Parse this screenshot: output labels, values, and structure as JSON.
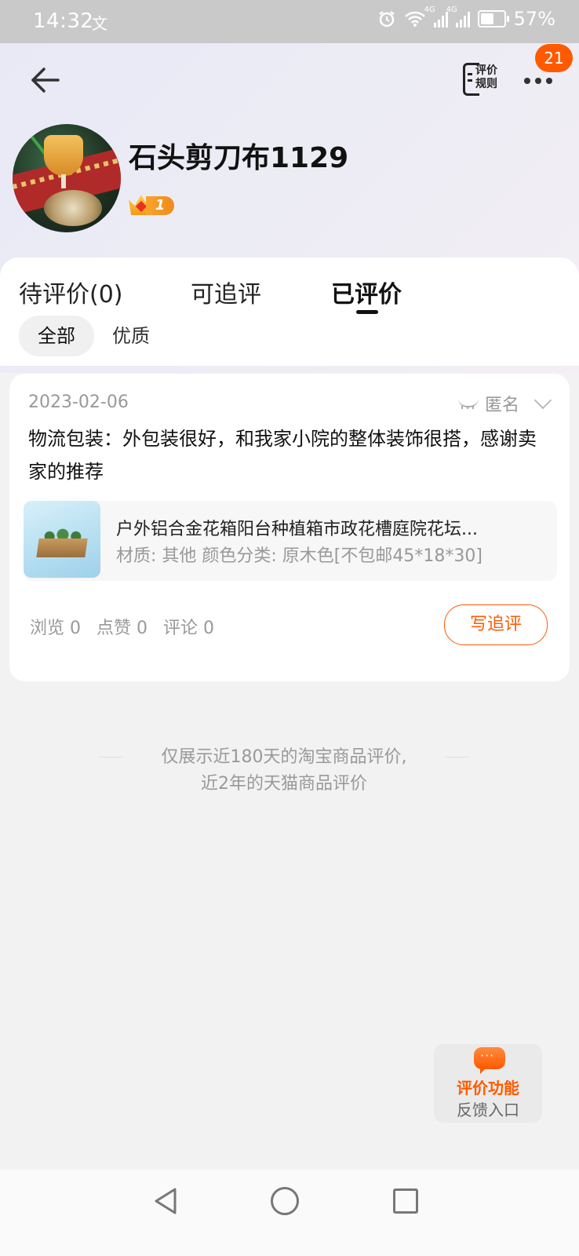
{
  "status_bar": {
    "time": "14:32",
    "time_glyph": "文",
    "signal_label_1": "4G",
    "signal_label_2": "4G",
    "battery_percent": "57%",
    "battery_level": 0.57
  },
  "header": {
    "rules_label": "评价规则",
    "notification_count": "21",
    "username": "石头剪刀布1129",
    "level": "1"
  },
  "tabs": [
    {
      "label": "待评价(0)"
    },
    {
      "label": "可追评"
    },
    {
      "label": "已评价"
    }
  ],
  "filters": [
    {
      "label": "全部"
    },
    {
      "label": "优质"
    }
  ],
  "review": {
    "date": "2023-02-06",
    "anonymous_label": "匿名",
    "text": "物流包装：外包装很好，和我家小院的整体装饰很搭，感谢卖家的推荐",
    "product_title": "户外铝合金花箱阳台种植箱市政花槽庭院花坛...",
    "product_spec": "材质: 其他 颜色分类: 原木色[不包邮45*18*30]",
    "stats": {
      "views": "浏览 0",
      "likes": "点赞 0",
      "comments": "评论 0"
    },
    "followup_button": "写追评"
  },
  "notice": {
    "line1": "仅展示近180天的淘宝商品评价,",
    "line2": "近2年的天猫商品评价"
  },
  "feedback": {
    "line1": "评价功能",
    "line2": "反馈入口"
  },
  "colors": {
    "accent": "#ff5a00",
    "page_background": "#f2f2f2"
  }
}
